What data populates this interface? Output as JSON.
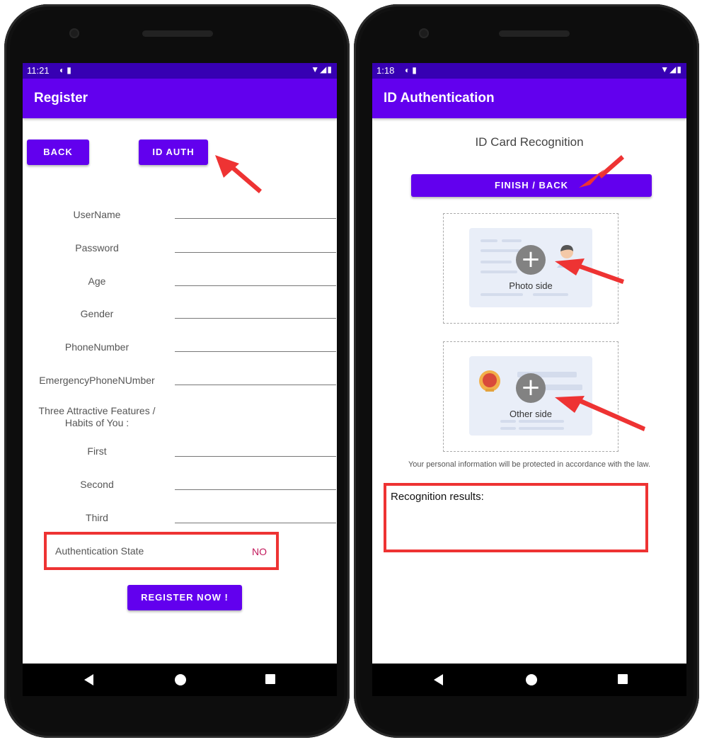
{
  "left_phone": {
    "status": {
      "time": "11:21",
      "left_icons": "◐ ▮",
      "right_icons": "▼◢▮"
    },
    "appbar_title": "Register",
    "back_button": "BACK",
    "id_auth_button": "ID AUTH",
    "fields": [
      {
        "label": "UserName",
        "value": ""
      },
      {
        "label": "Password",
        "value": ""
      },
      {
        "label": "Age",
        "value": ""
      },
      {
        "label": "Gender",
        "value": ""
      },
      {
        "label": "PhoneNumber",
        "value": ""
      },
      {
        "label": "EmergencyPhoneNUmber",
        "value": ""
      }
    ],
    "features_heading_line1": "Three Attractive Features /",
    "features_heading_line2": "Habits of You :",
    "features": [
      {
        "label": "First",
        "value": ""
      },
      {
        "label": "Second",
        "value": ""
      },
      {
        "label": "Third",
        "value": ""
      }
    ],
    "auth_state_label": "Authentication State",
    "auth_state_value": "NO",
    "register_button": "REGISTER NOW !"
  },
  "right_phone": {
    "status": {
      "time": "1:18",
      "left_icons": "◐ ▮",
      "right_icons": "▼◢▮"
    },
    "appbar_title": "ID Authentication",
    "heading": "ID Card Recognition",
    "finish_button": "FINISH / BACK",
    "photo_side_caption": "Photo side",
    "other_side_caption": "Other side",
    "privacy_notice": "Your personal information will be protected in accordance with the law.",
    "results_label": "Recognition results:"
  },
  "colors": {
    "primary": "#6200ee",
    "status_bar": "#3700b3",
    "highlight": "#ee3333",
    "auth_no": "#c2185b"
  },
  "icons": [
    "back-triangle-icon",
    "home-circle-icon",
    "recents-square-icon",
    "plus-icon",
    "wifi-icon",
    "signal-icon",
    "battery-icon"
  ]
}
